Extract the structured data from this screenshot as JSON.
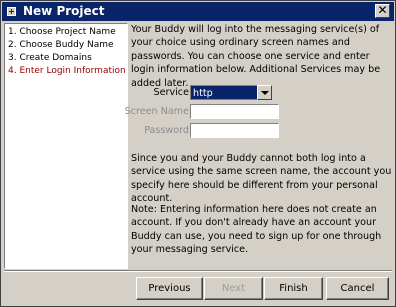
{
  "window": {
    "title": "New Project"
  },
  "title_icons": {
    "system": "system-menu-icon",
    "close": "close-icon",
    "close_glyph": "✕"
  },
  "steps": [
    {
      "label": "1. Choose Project Name",
      "active": false
    },
    {
      "label": "2. Choose Buddy Name",
      "active": false
    },
    {
      "label": "3. Create Domains",
      "active": false
    },
    {
      "label": "4. Enter Login Information",
      "active": true
    }
  ],
  "intro": "Your Buddy will log into the messaging service(s) of your choice using ordinary screen names and passwords. You can choose one service and enter login information below. Additional Services may be added later.",
  "form": {
    "service_label": "Service",
    "service_value": "http",
    "screen_name_label": "Screen Name",
    "screen_name_value": "",
    "password_label": "Password",
    "password_value": ""
  },
  "note1": "Since you and your Buddy cannot both log into a service using the same screen name, the account you specify here should be different from your personal account.",
  "note2": "Note: Entering information here does not create an account. If you don't already have an account your Buddy can use, you need to sign up for one through your messaging service.",
  "buttons": {
    "previous": "Previous",
    "next": "Next",
    "finish": "Finish",
    "cancel": "Cancel"
  },
  "colors": {
    "titlebar": "#0a246a",
    "active_step": "#990000",
    "dim_label": "#8c8c8c"
  }
}
